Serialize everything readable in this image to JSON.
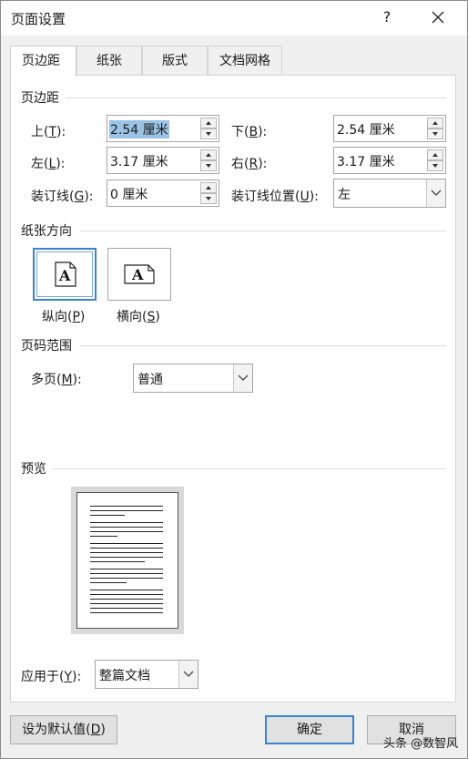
{
  "window": {
    "title": "页面设置",
    "help_label": "?",
    "close_icon": "close-icon"
  },
  "tabs": [
    {
      "label": "页边距",
      "active": true
    },
    {
      "label": "纸张",
      "active": false
    },
    {
      "label": "版式",
      "active": false
    },
    {
      "label": "文档网格",
      "active": false
    }
  ],
  "margins": {
    "section_title": "页边距",
    "top": {
      "label_prefix": "上(",
      "key": "T",
      "label_suffix": "):",
      "value": "2.54 厘米"
    },
    "bottom": {
      "label_prefix": "下(",
      "key": "B",
      "label_suffix": "):",
      "value": "2.54 厘米"
    },
    "left": {
      "label_prefix": "左(",
      "key": "L",
      "label_suffix": "):",
      "value": "3.17 厘米"
    },
    "right": {
      "label_prefix": "右(",
      "key": "R",
      "label_suffix": "):",
      "value": "3.17 厘米"
    },
    "gutter": {
      "label_prefix": "装订线(",
      "key": "G",
      "label_suffix": "):",
      "value": "0 厘米"
    },
    "gutter_position": {
      "label_prefix": "装订线位置(",
      "key": "U",
      "label_suffix": "):",
      "value": "左"
    }
  },
  "orientation": {
    "section_title": "纸张方向",
    "portrait": {
      "label_prefix": "纵向(",
      "key": "P",
      "label_suffix": ")",
      "glyph": "A",
      "selected": true
    },
    "landscape": {
      "label_prefix": "横向(",
      "key": "S",
      "label_suffix": ")",
      "glyph": "A",
      "selected": false
    }
  },
  "pages": {
    "section_title": "页码范围",
    "multiple": {
      "label_prefix": "多页(",
      "key": "M",
      "label_suffix": "):",
      "value": "普通"
    }
  },
  "preview": {
    "section_title": "预览",
    "apply_to": {
      "label_prefix": "应用于(",
      "key": "Y",
      "label_suffix": "):",
      "value": "整篇文档"
    }
  },
  "buttons": {
    "default": {
      "label_prefix": "设为默认值(",
      "key": "D",
      "label_suffix": ")"
    },
    "ok": "确定",
    "cancel": "取消"
  },
  "watermark": "头条 @数智风",
  "colors": {
    "accent": "#3c82d2",
    "selection": "#9bc3e6",
    "panel": "#ffffff",
    "chrome": "#f0f0f0"
  }
}
